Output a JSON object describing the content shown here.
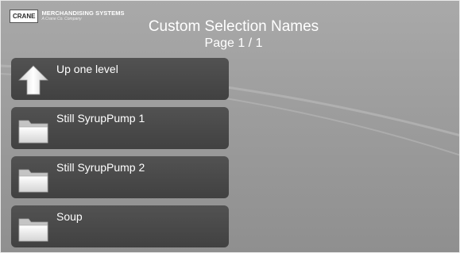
{
  "header": {
    "logo": {
      "brand": "CRANE",
      "company": "MERCHANDISING SYSTEMS",
      "tagline": "A Crane Co. Company"
    },
    "title": "Custom Selection Names",
    "page_indicator": "Page 1 / 1"
  },
  "list": {
    "items": [
      {
        "label": "Up one level",
        "icon": "up-arrow-icon"
      },
      {
        "label": "Still SyrupPump 1",
        "icon": "folder-icon"
      },
      {
        "label": "Still SyrupPump 2",
        "icon": "folder-icon"
      },
      {
        "label": "Soup",
        "icon": "folder-icon"
      }
    ]
  },
  "colors": {
    "background": "#a0a0a0",
    "item_background": "#4a4a4a",
    "text": "#ffffff"
  }
}
